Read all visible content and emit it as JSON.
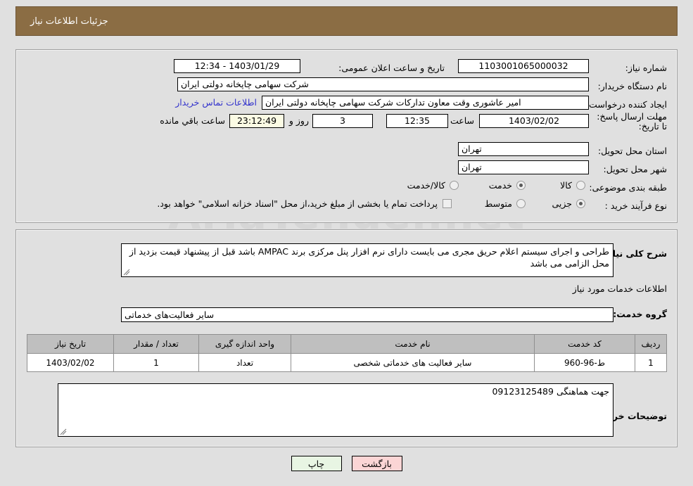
{
  "header": {
    "title": "جزئیات اطلاعات نیاز",
    "bar_color": "#8b6d44"
  },
  "watermark": {
    "text": "AriaTender.net"
  },
  "top_panel": {
    "need_number": {
      "label": "شماره نیاز:",
      "value": "1103001065000032"
    },
    "announce_datetime": {
      "label": "تاریخ و ساعت اعلان عمومی:",
      "value": "1403/01/29 - 12:34"
    },
    "buyer_org": {
      "label": "نام دستگاه خریدار:",
      "value": "شرکت سهامی چاپخانه دولتی ایران"
    },
    "request_creator": {
      "label": "ایجاد کننده درخواست:",
      "value": "امیر عاشوری وقت معاون تدارکات شرکت سهامی چاپخانه دولتی ایران",
      "contact_link": "اطلاعات تماس خریدار",
      "link_color": "#3333cc"
    },
    "deadline": {
      "label": "مهلت ارسال پاسخ: تا تاریخ:",
      "date": "1403/02/02",
      "hour_label": "ساعت",
      "hour": "12:35",
      "days": "3",
      "days_label": "روز و",
      "countdown": "23:12:49",
      "countdown_label": "ساعت باقي مانده",
      "countdown_bg": "#fbfbe4"
    },
    "delivery_province": {
      "label": "استان محل تحویل:",
      "value": "تهران"
    },
    "delivery_city": {
      "label": "شهر محل تحویل:",
      "value": "تهران"
    },
    "subject_class": {
      "label": "طبقه بندی موضوعی:",
      "options": [
        {
          "label": "کالا",
          "selected": false
        },
        {
          "label": "خدمت",
          "selected": true
        },
        {
          "label": "کالا/خدمت",
          "selected": false
        }
      ]
    },
    "purchase_type": {
      "label": "نوع فرآیند خرید :",
      "options": [
        {
          "label": "جزیی",
          "selected": true
        },
        {
          "label": "متوسط",
          "selected": false
        }
      ],
      "checkbox_label": "پرداخت تمام یا بخشی از مبلغ خرید،از محل \"اسناد خزانه اسلامی\" خواهد بود.",
      "checkbox_checked": false
    }
  },
  "bottom_panel": {
    "general_desc": {
      "label": "شرح کلی نیاز:",
      "value": "طراحی و اجرای سیستم اعلام حریق مجری می بایست دارای نرم افزار پنل مرکزی برند AMPAC باشد قبل از پیشنهاد قیمت بزدید از محل الزامی می باشد"
    },
    "services_section_title": "اطلاعات خدمات مورد نیاز",
    "service_group": {
      "label": "گروه خدمت:",
      "value": "سایر فعالیت‌های خدماتی"
    },
    "table": {
      "headers": [
        "ردیف",
        "کد خدمت",
        "نام خدمت",
        "واحد اندازه گیری",
        "تعداد / مقدار",
        "تاریخ نیاز"
      ],
      "rows": [
        [
          "1",
          "ط-96-960",
          "سایر فعالیت های خدماتی شخصی",
          "تعداد",
          "1",
          "1403/02/02"
        ]
      ]
    },
    "buyer_notes": {
      "label": "توضیحات خریدار:",
      "value": "جهت هماهنگی 09123125489"
    }
  },
  "footer": {
    "print_label": "چاپ",
    "back_label": "بازگشت",
    "print_bg": "#e8f5e3",
    "back_bg": "#fbd5d5"
  }
}
